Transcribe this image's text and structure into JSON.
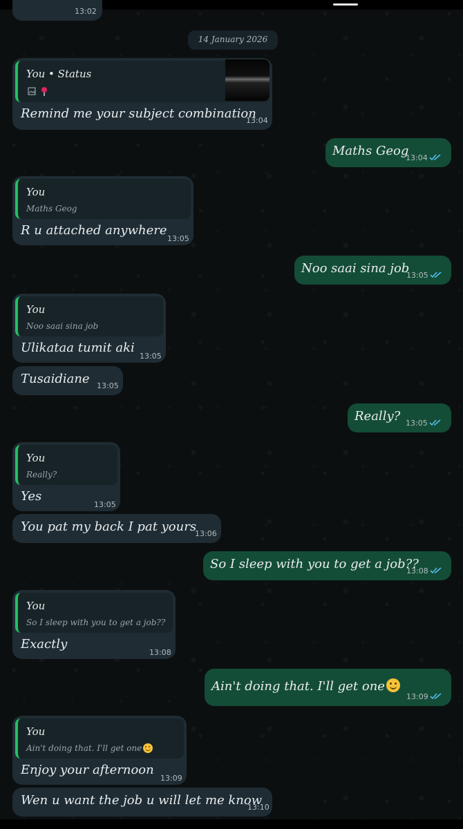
{
  "date_separator": "14 January 2026",
  "top_partial_time": "13:02",
  "colors": {
    "incoming": "#1f2c33",
    "outgoing": "#144d37",
    "quote_bar": "#21c063",
    "read_ticks": "#53bdeb"
  },
  "messages": [
    {
      "dir": "in",
      "quote_author": "You • Status",
      "quote_text": "",
      "quote_icons": [
        "image-icon",
        "pin-icon"
      ],
      "text": "Remind me your subject combination",
      "time": "13:04"
    },
    {
      "dir": "out",
      "text": "Maths Geog",
      "time": "13:04",
      "status": "read"
    },
    {
      "dir": "in",
      "quote_author": "You",
      "quote_text": "Maths Geog",
      "text": "R u attached anywhere",
      "time": "13:05"
    },
    {
      "dir": "out",
      "text": "Noo saai sina job",
      "time": "13:05",
      "status": "read"
    },
    {
      "dir": "in",
      "quote_author": "You",
      "quote_text": "Noo saai sina job",
      "text": "Ulikataa tumit aki",
      "time": "13:05"
    },
    {
      "dir": "in",
      "text": "Tusaidiane",
      "time": "13:05"
    },
    {
      "dir": "out",
      "text": "Really?",
      "time": "13:05",
      "status": "read"
    },
    {
      "dir": "in",
      "quote_author": "You",
      "quote_text": "Really?",
      "text": "Yes",
      "time": "13:05"
    },
    {
      "dir": "in",
      "text": "You pat my back I pat yours",
      "time": "13:06"
    },
    {
      "dir": "out",
      "text": "So I sleep with you to get a job??",
      "time": "13:08",
      "status": "read"
    },
    {
      "dir": "in",
      "quote_author": "You",
      "quote_text": "So I sleep with you to get a job??",
      "text": "Exactly",
      "time": "13:08"
    },
    {
      "dir": "out",
      "text": "Ain't doing that.  I'll get one",
      "emoji": "smiling-face-emoji",
      "time": "13:09",
      "status": "read"
    },
    {
      "dir": "in",
      "quote_author": "You",
      "quote_text": "Ain't doing that.  I'll get one",
      "quote_emoji": "smiling-face-emoji",
      "text": "Enjoy your afternoon",
      "time": "13:09"
    },
    {
      "dir": "in",
      "text": "Wen u want the job u will let me know",
      "time": "13:10"
    }
  ]
}
